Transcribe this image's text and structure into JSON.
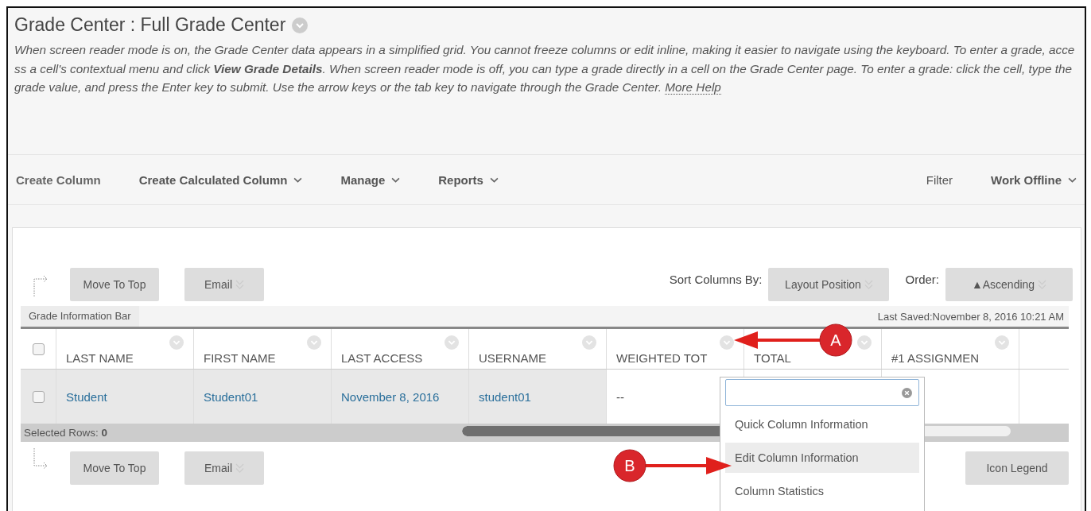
{
  "page": {
    "title": "Grade Center : Full Grade Center",
    "description": "When screen reader mode is on, the Grade Center data appears in a simplified grid. You cannot freeze columns or edit inline, making it easier to navigate using the keyboard. To enter a grade, access a cell's contextual menu and click **View Grade Details**. When screen reader mode is off, you can type a grade directly in a cell on the Grade Center page. To enter a grade: click the cell, type the grade value, and press the Enter key to submit. Use the arrow keys or the tab key to navigate through the Grade Center.",
    "help_link": "More Help"
  },
  "actions": [
    {
      "label": "Create Column",
      "kind": "plain"
    },
    {
      "label": "Create Calculated Column",
      "kind": "menu"
    },
    {
      "label": "Manage",
      "kind": "menu"
    },
    {
      "label": "Reports",
      "kind": "menu"
    }
  ],
  "right_actions": [
    {
      "label": "Filter",
      "kind": "plain"
    },
    {
      "label": "Work Offline",
      "kind": "menu"
    }
  ],
  "top_toolbar": {
    "buttons": [
      {
        "label": "Move To Top",
        "kind": "plain"
      },
      {
        "label": "Email",
        "kind": "menu"
      }
    ],
    "sort_label": "Sort Columns By:",
    "sort_value": "Layout Position",
    "order_label": "Order:",
    "order_value": "▲Ascending"
  },
  "info_bar": {
    "label": "Grade Information Bar",
    "last_saved": "Last Saved:November 8, 2016 10:21 AM"
  },
  "table": {
    "header_checked": false,
    "columns": [
      "LAST NAME",
      "FIRST NAME",
      "LAST ACCESS",
      "USERNAME",
      "WEIGHTED TOT",
      "TOTAL",
      "#1 ASSIGNMEN"
    ],
    "rows": [
      {
        "checked": false,
        "cells": [
          {
            "text": "Student",
            "kind": "link"
          },
          {
            "text": "Student01",
            "kind": "link"
          },
          {
            "text": "November 8, 2016",
            "kind": "link"
          },
          {
            "text": "student01",
            "kind": "link"
          },
          {
            "text": "--",
            "kind": "plain"
          }
        ]
      }
    ]
  },
  "selected_rows": {
    "label": "Selected Rows:",
    "count": "0"
  },
  "bottom_toolbar": {
    "buttons": [
      {
        "label": "Move To Top",
        "kind": "plain"
      },
      {
        "label": "Email",
        "kind": "menu"
      }
    ],
    "legend": "Icon Legend"
  },
  "column_menu": {
    "items": [
      {
        "label": "Quick Column Information",
        "selected": false
      },
      {
        "label": "Edit Column Information",
        "selected": true
      },
      {
        "label": "Column Statistics",
        "selected": false
      }
    ]
  },
  "callouts": [
    {
      "label": "A"
    },
    {
      "label": "B"
    }
  ]
}
